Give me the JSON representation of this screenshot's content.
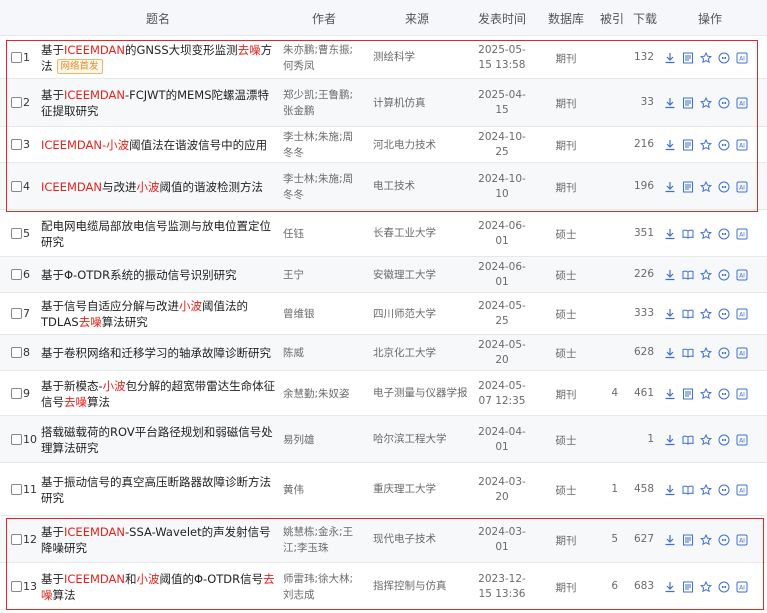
{
  "header": {
    "title_col": "题名",
    "author_col": "作者",
    "source_col": "来源",
    "date_col": "发表时间",
    "db_col": "数据库",
    "cite_col": "被引",
    "download_col": "下载",
    "ops_col": "操作"
  },
  "colors": {
    "highlight": "#e8211c",
    "box": "#e0272b",
    "icon": "#3e6fd6"
  },
  "rows": [
    {
      "num": "1",
      "title_parts": [
        [
          "基于",
          0
        ],
        [
          "ICEEMDAN",
          1
        ],
        [
          "的GNSS大坝变形监测",
          0
        ],
        [
          "去噪",
          1
        ],
        [
          "方法",
          0
        ]
      ],
      "tag": "网络首发",
      "author": "朱亦鹏;曹东振;何秀凤",
      "source": "测绘科学",
      "date": "2025-05-15 13:58",
      "db": "期刊",
      "cite": "",
      "downloads": "132",
      "ops": [
        "download-icon",
        "html-read-icon",
        "star-icon",
        "quote-icon",
        "ai-icon"
      ]
    },
    {
      "num": "2",
      "title_parts": [
        [
          "基于",
          0
        ],
        [
          "ICEEMDAN",
          1
        ],
        [
          "-FCJWT的MEMS陀螺温漂特征提取研究",
          0
        ]
      ],
      "tag": "",
      "author": "郑少凯;王鲁鹏;张金鹏",
      "source": "计算机仿真",
      "date": "2025-04-15",
      "db": "期刊",
      "cite": "",
      "downloads": "33",
      "ops": [
        "download-icon",
        "html-read-icon",
        "star-icon",
        "quote-icon",
        "ai-icon"
      ]
    },
    {
      "num": "3",
      "title_parts": [
        [
          "ICEEMDAN-小波",
          1
        ],
        [
          "阈值法在谐波信号中的应用",
          0
        ]
      ],
      "tag": "",
      "author": "李士林;朱施;周冬冬",
      "source": "河北电力技术",
      "date": "2024-10-25",
      "db": "期刊",
      "cite": "",
      "downloads": "216",
      "ops": [
        "download-icon",
        "html-read-icon",
        "star-icon",
        "quote-icon",
        "ai-icon"
      ]
    },
    {
      "num": "4",
      "title_parts": [
        [
          "ICEEMDAN",
          1
        ],
        [
          "与改进",
          0
        ],
        [
          "小波",
          1
        ],
        [
          "阈值的谐波检测方法",
          0
        ]
      ],
      "tag": "",
      "author": "李士林;朱施;周冬冬",
      "source": "电工技术",
      "date": "2024-10-10",
      "db": "期刊",
      "cite": "",
      "downloads": "196",
      "ops": [
        "download-icon",
        "html-read-icon",
        "star-icon",
        "quote-icon",
        "ai-icon"
      ]
    },
    {
      "num": "5",
      "title_parts": [
        [
          "配电网电缆局部放电信号监测与放电位置定位研究",
          0
        ]
      ],
      "tag": "",
      "author": "任钰",
      "source": "长春工业大学",
      "date": "2024-06-01",
      "db": "硕士",
      "cite": "",
      "downloads": "351",
      "ops": [
        "download-icon",
        "book-icon",
        "star-icon",
        "quote-icon",
        "ai-icon"
      ]
    },
    {
      "num": "6",
      "title_parts": [
        [
          "基于Φ-OTDR系统的振动信号识别研究",
          0
        ]
      ],
      "tag": "",
      "author": "王宁",
      "source": "安徽理工大学",
      "date": "2024-06-01",
      "db": "硕士",
      "cite": "",
      "downloads": "226",
      "ops": [
        "download-icon",
        "book-icon",
        "star-icon",
        "quote-icon",
        "ai-icon"
      ]
    },
    {
      "num": "7",
      "title_parts": [
        [
          "基于信号自适应分解与改进",
          0
        ],
        [
          "小波",
          1
        ],
        [
          "阈值法的TDLAS",
          0
        ],
        [
          "去噪",
          1
        ],
        [
          "算法研究",
          0
        ]
      ],
      "tag": "",
      "author": "曾维银",
      "source": "四川师范大学",
      "date": "2024-05-25",
      "db": "硕士",
      "cite": "",
      "downloads": "333",
      "ops": [
        "download-icon",
        "book-icon",
        "star-icon",
        "quote-icon",
        "ai-icon"
      ]
    },
    {
      "num": "8",
      "title_parts": [
        [
          "基于卷积网络和迁移学习的轴承故障诊断研究",
          0
        ]
      ],
      "tag": "",
      "author": "陈威",
      "source": "北京化工大学",
      "date": "2024-05-20",
      "db": "硕士",
      "cite": "",
      "downloads": "628",
      "ops": [
        "download-icon",
        "book-icon",
        "star-icon",
        "quote-icon",
        "ai-icon"
      ]
    },
    {
      "num": "9",
      "title_parts": [
        [
          "基于新模态-",
          0
        ],
        [
          "小波",
          1
        ],
        [
          "包分解的超宽带雷达生命体征信号",
          0
        ],
        [
          "去噪",
          1
        ],
        [
          "算法",
          0
        ]
      ],
      "tag": "",
      "author": "余慧勤;朱奴姿",
      "source": "电子测量与仪器学报",
      "date": "2024-05-07 12:35",
      "db": "期刊",
      "cite": "4",
      "downloads": "461",
      "ops": [
        "download-icon",
        "html-read-icon",
        "star-icon",
        "quote-icon",
        "ai-icon"
      ]
    },
    {
      "num": "10",
      "title_parts": [
        [
          "搭载磁载荷的ROV平台路径规划和弱磁信号处理算法研究",
          0
        ]
      ],
      "tag": "",
      "author": "易列雄",
      "source": "哈尔滨工程大学",
      "date": "2024-04-01",
      "db": "硕士",
      "cite": "",
      "downloads": "1",
      "ops": [
        "download-icon",
        "book-icon",
        "star-icon",
        "quote-icon",
        "ai-icon"
      ]
    },
    {
      "num": "11",
      "title_parts": [
        [
          "基于振动信号的真空高压断路器故障诊断方法研究",
          0
        ]
      ],
      "tag": "",
      "author": "黄伟",
      "source": "重庆理工大学",
      "date": "2024-03-20",
      "db": "硕士",
      "cite": "1",
      "downloads": "458",
      "ops": [
        "download-icon",
        "book-icon",
        "star-icon",
        "quote-icon",
        "ai-icon"
      ]
    },
    {
      "num": "12",
      "title_parts": [
        [
          "基于",
          0
        ],
        [
          "ICEEMDAN",
          1
        ],
        [
          "-SSA-Wavelet的声发射信号降噪研究",
          0
        ]
      ],
      "tag": "",
      "author": "姚慧栋;金永;王江;李玉珠",
      "source": "现代电子技术",
      "date": "2024-03-01",
      "db": "期刊",
      "cite": "5",
      "downloads": "627",
      "ops": [
        "download-icon",
        "html-read-icon",
        "star-icon",
        "quote-icon",
        "ai-icon"
      ]
    },
    {
      "num": "13",
      "title_parts": [
        [
          "基于",
          0
        ],
        [
          "ICEEMDAN",
          1
        ],
        [
          "和",
          0
        ],
        [
          "小波",
          1
        ],
        [
          "阈值的Φ-OTDR信号",
          0
        ],
        [
          "去噪",
          1
        ],
        [
          "算法",
          0
        ]
      ],
      "tag": "",
      "author": "师雷玮;徐大林;刘志成",
      "source": "指挥控制与仿真",
      "date": "2023-12-15 13:36",
      "db": "期刊",
      "cite": "6",
      "downloads": "683",
      "ops": [
        "download-icon",
        "html-read-icon",
        "star-icon",
        "quote-icon",
        "ai-icon"
      ]
    }
  ]
}
